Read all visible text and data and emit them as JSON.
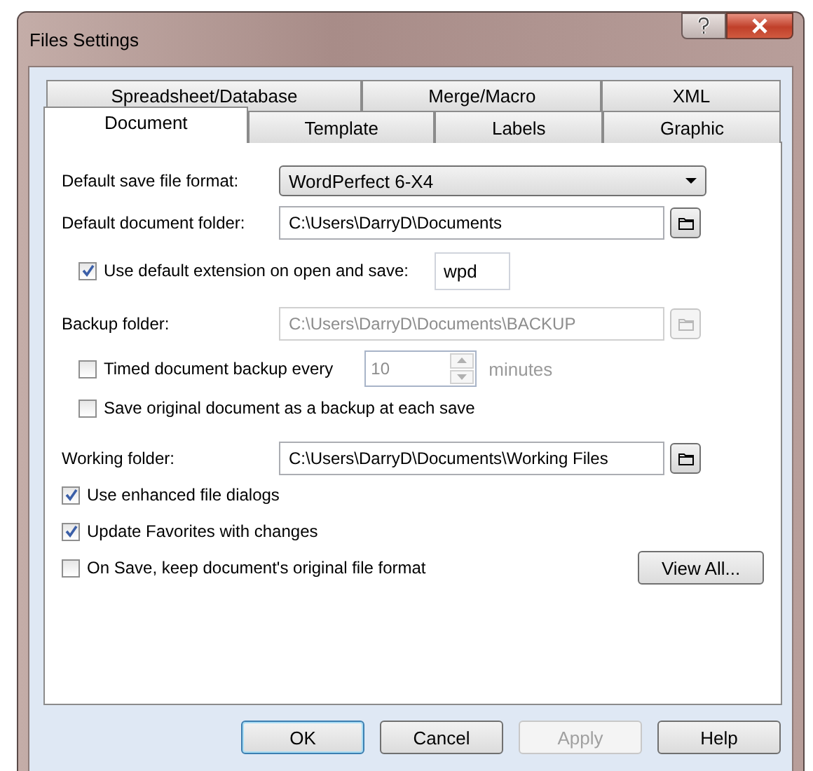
{
  "window": {
    "title": "Files Settings"
  },
  "tab_rows": [
    [
      {
        "label": "Spreadsheet/Database",
        "selected": false
      },
      {
        "label": "Merge/Macro",
        "selected": false
      },
      {
        "label": "XML",
        "selected": false
      }
    ],
    [
      {
        "label": "Document",
        "selected": true
      },
      {
        "label": "Template",
        "selected": false
      },
      {
        "label": "Labels",
        "selected": false
      },
      {
        "label": "Graphic",
        "selected": false
      }
    ]
  ],
  "save_format": {
    "label": "Default save file format:",
    "value": "WordPerfect 6-X4"
  },
  "document_folder": {
    "label": "Default document folder:",
    "value": "C:\\Users\\DarryD\\Documents",
    "disabled": false
  },
  "use_default_extension": {
    "label": "Use default extension on open and save:",
    "checked": true,
    "value": "wpd"
  },
  "backup_folder": {
    "label": "Backup folder:",
    "value": "C:\\Users\\DarryD\\Documents\\BACKUP",
    "disabled": true
  },
  "timed_backup": {
    "label": "Timed document backup every",
    "checked": false,
    "value": "10",
    "unit": "minutes",
    "disabled": true
  },
  "save_original_backup": {
    "label": "Save original document as a backup at each save",
    "checked": false
  },
  "working_folder": {
    "label": "Working folder:",
    "value": "C:\\Users\\DarryD\\Documents\\Working Files",
    "disabled": false
  },
  "options": [
    {
      "label": "Use enhanced file dialogs",
      "checked": true
    },
    {
      "label": "Update Favorites with changes",
      "checked": true
    },
    {
      "label": "On Save, keep document's original file format",
      "checked": false
    }
  ],
  "view_all_button": "View All...",
  "buttons": [
    {
      "label": "OK",
      "default": true,
      "disabled": false
    },
    {
      "label": "Cancel",
      "default": false,
      "disabled": false
    },
    {
      "label": "Apply",
      "default": false,
      "disabled": true
    },
    {
      "label": "Help",
      "default": false,
      "disabled": false
    }
  ]
}
